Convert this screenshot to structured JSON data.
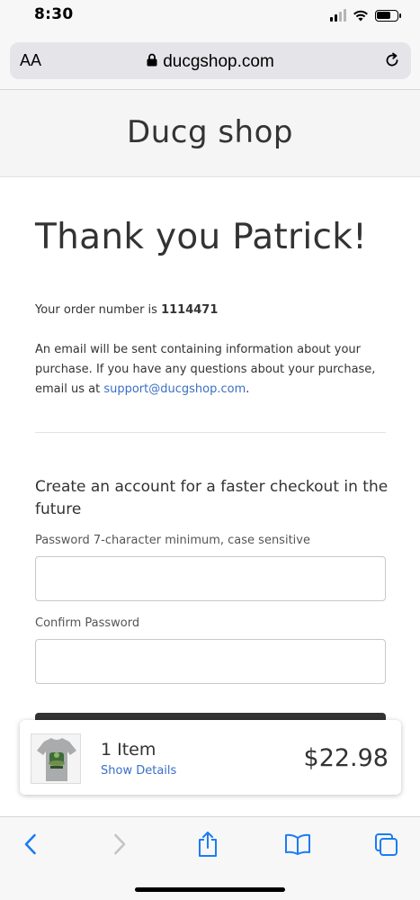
{
  "status": {
    "time": "8:30",
    "battery_level": 0.7,
    "signal_bars": 2
  },
  "browser": {
    "text_size_label": "AA",
    "url": "ducgshop.com"
  },
  "shop": {
    "name": "Ducg shop"
  },
  "confirmation": {
    "title": "Thank you Patrick!",
    "order_prefix": "Your order number is ",
    "order_number": "1114471",
    "email_text": "An email will be sent containing information about your purchase. If you have any questions about your purchase, email us at ",
    "support_email": "support@ducgshop.com",
    "email_suffix": "."
  },
  "account": {
    "heading": "Create an account for a faster checkout in the future",
    "password_label": "Password 7-character minimum, case sensitive",
    "confirm_label": "Confirm Password"
  },
  "cart": {
    "item_count": "1 Item",
    "details_link": "Show Details",
    "total": "$22.98"
  },
  "colors": {
    "link": "#3a6fc4",
    "ios_blue": "#1a7cf5",
    "text": "#333333"
  },
  "icons": {
    "lock": "lock-icon",
    "reload": "reload-icon",
    "back": "chevron-left-icon",
    "forward": "chevron-right-icon",
    "share": "share-icon",
    "bookmarks": "book-icon",
    "tabs": "tabs-icon"
  }
}
